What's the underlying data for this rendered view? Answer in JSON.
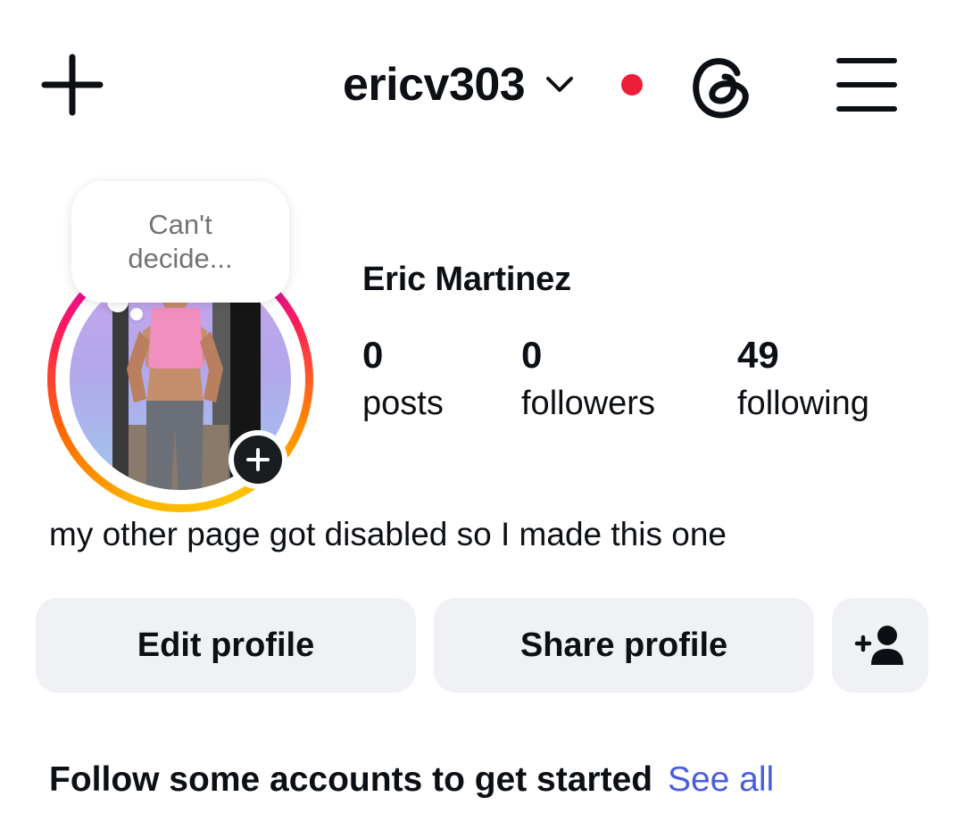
{
  "header": {
    "username": "ericv303",
    "icons": {
      "create": "plus-icon",
      "account_switch": "chevron-down-icon",
      "notification": "red-dot",
      "threads": "threads-icon",
      "menu": "hamburger-menu-icon"
    }
  },
  "colors": {
    "notification_dot": "#ee1d3a",
    "link": "#4a5fd9",
    "button_bg": "#eff1f5"
  },
  "note": {
    "line1": "Can't",
    "line2": "decide..."
  },
  "profile": {
    "full_name": "Eric Martinez",
    "bio": "my other page got disabled so I made this one"
  },
  "stats": [
    {
      "value": "0",
      "label": "posts"
    },
    {
      "value": "0",
      "label": "followers"
    },
    {
      "value": "49",
      "label": "following"
    }
  ],
  "actions": {
    "edit_profile": "Edit profile",
    "share_profile": "Share profile",
    "add_user_icon": "person-add-icon"
  },
  "suggestions": {
    "title": "Follow some accounts to get started",
    "see_all": "See all"
  }
}
